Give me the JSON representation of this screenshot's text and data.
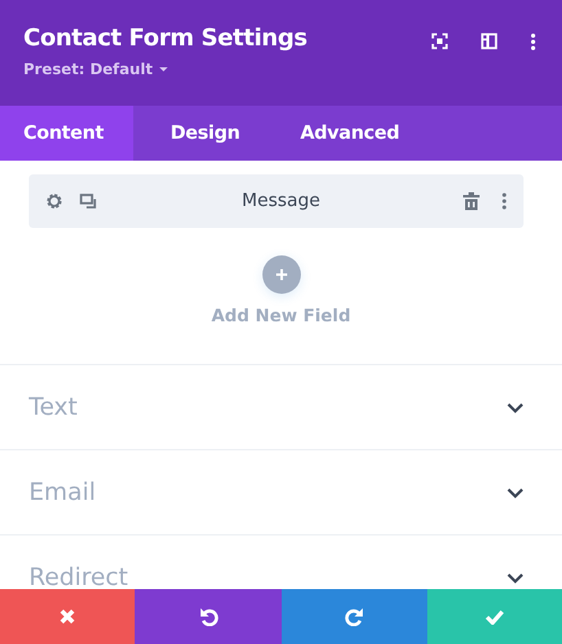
{
  "header": {
    "title": "Contact Form Settings",
    "preset": "Preset: Default"
  },
  "tabs": [
    {
      "label": "Content",
      "selected": true
    },
    {
      "label": "Design",
      "selected": false
    },
    {
      "label": "Advanced",
      "selected": false
    }
  ],
  "fields": [
    {
      "label": "Message"
    }
  ],
  "add_field": {
    "label": "Add New Field"
  },
  "sections": [
    {
      "label": "Text",
      "expanded": false
    },
    {
      "label": "Email",
      "expanded": false
    },
    {
      "label": "Redirect",
      "expanded": false
    }
  ],
  "actions": [
    {
      "kind": "cancel"
    },
    {
      "kind": "undo"
    },
    {
      "kind": "redo"
    },
    {
      "kind": "save"
    }
  ]
}
